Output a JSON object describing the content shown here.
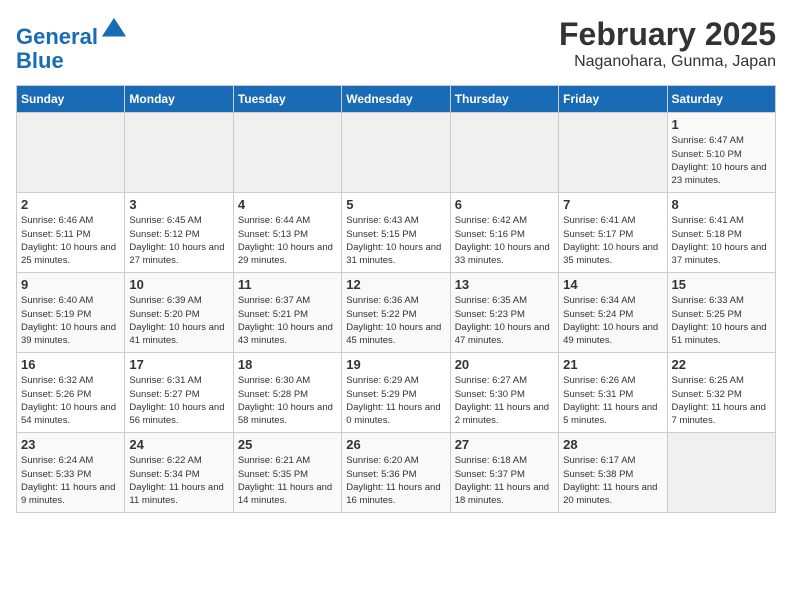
{
  "header": {
    "logo_line1": "General",
    "logo_line2": "Blue",
    "month_title": "February 2025",
    "location": "Naganohara, Gunma, Japan"
  },
  "weekdays": [
    "Sunday",
    "Monday",
    "Tuesday",
    "Wednesday",
    "Thursday",
    "Friday",
    "Saturday"
  ],
  "weeks": [
    [
      {
        "day": "",
        "info": ""
      },
      {
        "day": "",
        "info": ""
      },
      {
        "day": "",
        "info": ""
      },
      {
        "day": "",
        "info": ""
      },
      {
        "day": "",
        "info": ""
      },
      {
        "day": "",
        "info": ""
      },
      {
        "day": "1",
        "info": "Sunrise: 6:47 AM\nSunset: 5:10 PM\nDaylight: 10 hours and 23 minutes."
      }
    ],
    [
      {
        "day": "2",
        "info": "Sunrise: 6:46 AM\nSunset: 5:11 PM\nDaylight: 10 hours and 25 minutes."
      },
      {
        "day": "3",
        "info": "Sunrise: 6:45 AM\nSunset: 5:12 PM\nDaylight: 10 hours and 27 minutes."
      },
      {
        "day": "4",
        "info": "Sunrise: 6:44 AM\nSunset: 5:13 PM\nDaylight: 10 hours and 29 minutes."
      },
      {
        "day": "5",
        "info": "Sunrise: 6:43 AM\nSunset: 5:15 PM\nDaylight: 10 hours and 31 minutes."
      },
      {
        "day": "6",
        "info": "Sunrise: 6:42 AM\nSunset: 5:16 PM\nDaylight: 10 hours and 33 minutes."
      },
      {
        "day": "7",
        "info": "Sunrise: 6:41 AM\nSunset: 5:17 PM\nDaylight: 10 hours and 35 minutes."
      },
      {
        "day": "8",
        "info": "Sunrise: 6:41 AM\nSunset: 5:18 PM\nDaylight: 10 hours and 37 minutes."
      }
    ],
    [
      {
        "day": "9",
        "info": "Sunrise: 6:40 AM\nSunset: 5:19 PM\nDaylight: 10 hours and 39 minutes."
      },
      {
        "day": "10",
        "info": "Sunrise: 6:39 AM\nSunset: 5:20 PM\nDaylight: 10 hours and 41 minutes."
      },
      {
        "day": "11",
        "info": "Sunrise: 6:37 AM\nSunset: 5:21 PM\nDaylight: 10 hours and 43 minutes."
      },
      {
        "day": "12",
        "info": "Sunrise: 6:36 AM\nSunset: 5:22 PM\nDaylight: 10 hours and 45 minutes."
      },
      {
        "day": "13",
        "info": "Sunrise: 6:35 AM\nSunset: 5:23 PM\nDaylight: 10 hours and 47 minutes."
      },
      {
        "day": "14",
        "info": "Sunrise: 6:34 AM\nSunset: 5:24 PM\nDaylight: 10 hours and 49 minutes."
      },
      {
        "day": "15",
        "info": "Sunrise: 6:33 AM\nSunset: 5:25 PM\nDaylight: 10 hours and 51 minutes."
      }
    ],
    [
      {
        "day": "16",
        "info": "Sunrise: 6:32 AM\nSunset: 5:26 PM\nDaylight: 10 hours and 54 minutes."
      },
      {
        "day": "17",
        "info": "Sunrise: 6:31 AM\nSunset: 5:27 PM\nDaylight: 10 hours and 56 minutes."
      },
      {
        "day": "18",
        "info": "Sunrise: 6:30 AM\nSunset: 5:28 PM\nDaylight: 10 hours and 58 minutes."
      },
      {
        "day": "19",
        "info": "Sunrise: 6:29 AM\nSunset: 5:29 PM\nDaylight: 11 hours and 0 minutes."
      },
      {
        "day": "20",
        "info": "Sunrise: 6:27 AM\nSunset: 5:30 PM\nDaylight: 11 hours and 2 minutes."
      },
      {
        "day": "21",
        "info": "Sunrise: 6:26 AM\nSunset: 5:31 PM\nDaylight: 11 hours and 5 minutes."
      },
      {
        "day": "22",
        "info": "Sunrise: 6:25 AM\nSunset: 5:32 PM\nDaylight: 11 hours and 7 minutes."
      }
    ],
    [
      {
        "day": "23",
        "info": "Sunrise: 6:24 AM\nSunset: 5:33 PM\nDaylight: 11 hours and 9 minutes."
      },
      {
        "day": "24",
        "info": "Sunrise: 6:22 AM\nSunset: 5:34 PM\nDaylight: 11 hours and 11 minutes."
      },
      {
        "day": "25",
        "info": "Sunrise: 6:21 AM\nSunset: 5:35 PM\nDaylight: 11 hours and 14 minutes."
      },
      {
        "day": "26",
        "info": "Sunrise: 6:20 AM\nSunset: 5:36 PM\nDaylight: 11 hours and 16 minutes."
      },
      {
        "day": "27",
        "info": "Sunrise: 6:18 AM\nSunset: 5:37 PM\nDaylight: 11 hours and 18 minutes."
      },
      {
        "day": "28",
        "info": "Sunrise: 6:17 AM\nSunset: 5:38 PM\nDaylight: 11 hours and 20 minutes."
      },
      {
        "day": "",
        "info": ""
      }
    ]
  ]
}
